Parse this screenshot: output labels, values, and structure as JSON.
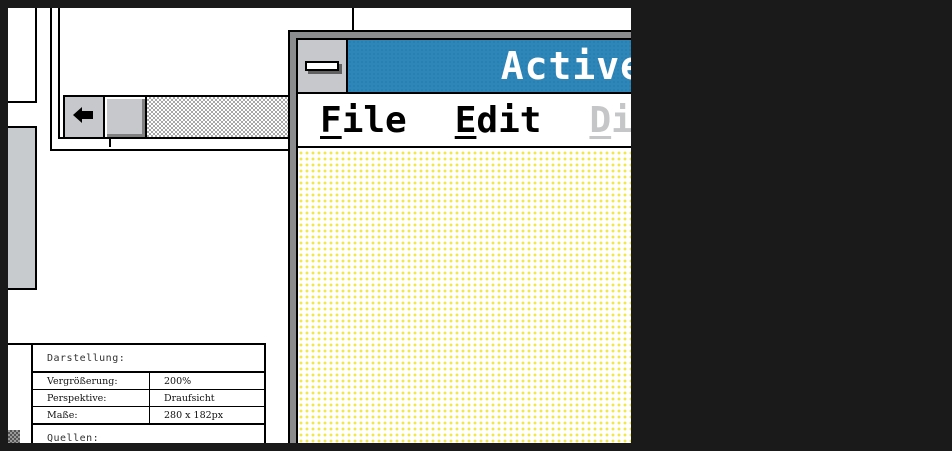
{
  "active_window": {
    "title": "Active",
    "menu": [
      {
        "label": "File",
        "mnemonic": "F",
        "rest": "ile",
        "enabled": true
      },
      {
        "label": "Edit",
        "mnemonic": "E",
        "rest": "dit",
        "enabled": true
      },
      {
        "label": "Displ",
        "mnemonic": "D",
        "rest": "ispl",
        "enabled": false
      }
    ]
  },
  "back_window": {
    "scroll_left_icon": "arrow-left-icon"
  },
  "info_table": {
    "heading": "Darstellung:",
    "rows": [
      {
        "key": "Vergrößerung:",
        "value": "200%"
      },
      {
        "key": "Perspektive:",
        "value": "Draufsicht"
      },
      {
        "key": "Maße:",
        "value": "280 x 182px"
      }
    ],
    "footer": "Quellen:"
  },
  "colors": {
    "title_bar": "#2e86b8",
    "window_frame": "#8a8c8e",
    "client_dots": "#f2e84a",
    "button_face": "#c6c8cb"
  }
}
